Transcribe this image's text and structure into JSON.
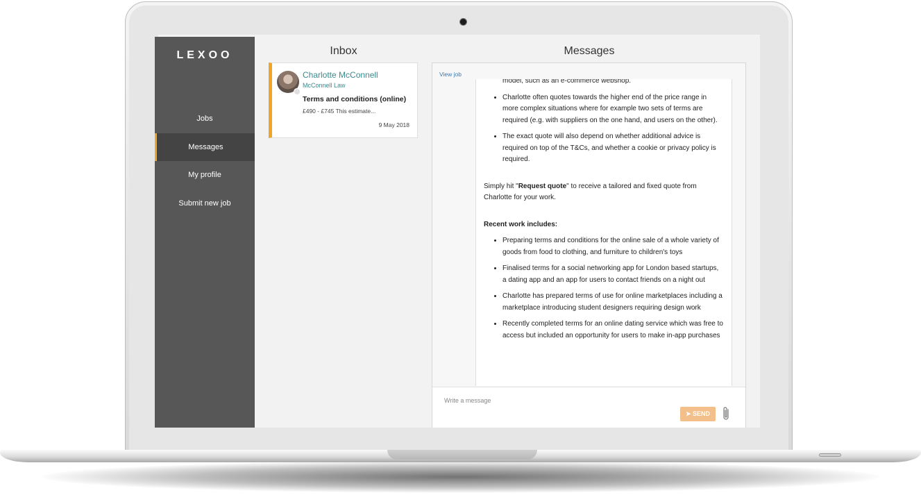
{
  "brand": "LEXOO",
  "nav": [
    {
      "label": "Jobs",
      "active": false
    },
    {
      "label": "Messages",
      "active": true
    },
    {
      "label": "My profile",
      "active": false
    },
    {
      "label": "Submit new job",
      "active": false
    }
  ],
  "inbox": {
    "title": "Inbox",
    "conversation": {
      "name": "Charlotte McConnell",
      "company": "McConnell Law",
      "subject": "Terms and conditions (online)",
      "preview": "£490 - £745 This estimate...",
      "date": "9 May 2018"
    }
  },
  "messages": {
    "title": "Messages",
    "view_job": "View job",
    "top_fragment": "model, such as an e-commerce webshop.",
    "pricing_bullets": [
      "Charlotte often quotes towards the higher end of the price range in more complex situations where for example two sets of terms are required (e.g. with suppliers on the one hand, and users on the other).",
      "The exact quote will also depend on whether additional advice is required on top of the T&Cs, and whether a cookie or privacy policy is required."
    ],
    "cta_before": "Simply hit \"",
    "cta_bold": "Request quote",
    "cta_after": "\" to receive a tailored and fixed quote from Charlotte for your work.",
    "recent_heading": "Recent work includes:",
    "recent_bullets": [
      "Preparing terms and conditions for the online sale of a whole variety of goods from food to clothing, and furniture to children's toys",
      "Finalised terms for a social networking app for London based startups, a dating app and an app for users to contact friends on a night out",
      "Charlotte has prepared terms of use for online marketplaces including a marketplace introducing student designers requiring design work",
      "Recently completed terms for an online dating service which was free to access but included an opportunity for users to make in-app purchases"
    ],
    "compose_placeholder": "Write a message",
    "send_label": "SEND",
    "accent_color": "#f0a52a"
  }
}
